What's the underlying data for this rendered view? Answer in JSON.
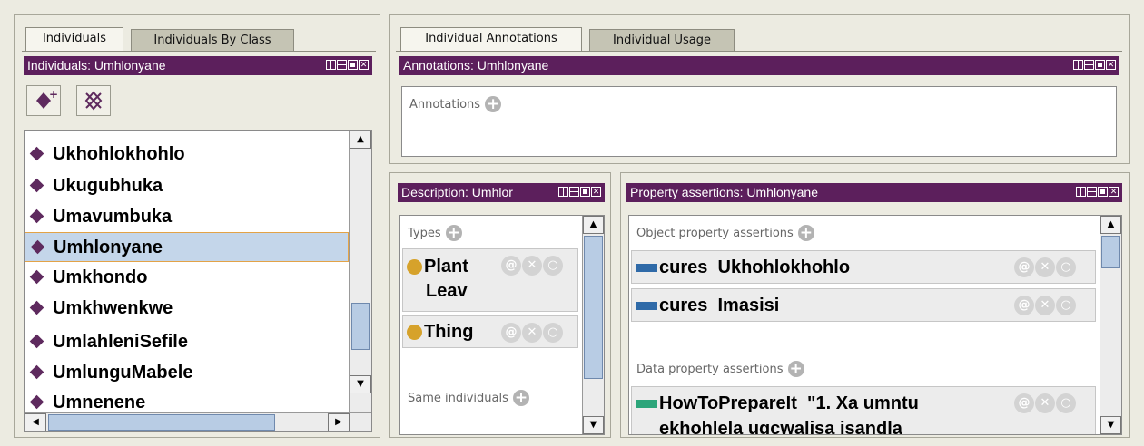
{
  "left_panel": {
    "tabs": [
      "Individuals",
      "Individuals By Class"
    ],
    "title": "Individuals: Umhlonyane",
    "add_individual_icon": "add-individual-icon",
    "delete_individual_icon": "delete-individual-icon",
    "items": [
      {
        "label": "Ukhohlokhohlo"
      },
      {
        "label": "Ukugubhuka"
      },
      {
        "label": "Umavumbuka"
      },
      {
        "label": "Umhlonyane",
        "selected": true
      },
      {
        "label": "Umkhondo"
      },
      {
        "label": "Umkhwenkwe"
      },
      {
        "label": "UmlahleniSefile"
      },
      {
        "label": "UmlunguMabele"
      },
      {
        "label": "Umnenene"
      }
    ]
  },
  "annotations_panel": {
    "tabs": [
      "Individual Annotations",
      "Individual Usage"
    ],
    "title": "Annotations: Umhlonyane",
    "section_label": "Annotations"
  },
  "description_panel": {
    "title": "Description: Umhlor",
    "types_label": "Types",
    "types": [
      {
        "line1": "Plant",
        "line2": "Leav"
      },
      {
        "line1": "Thing",
        "line2": ""
      }
    ],
    "same_individuals_label": "Same individuals"
  },
  "property_panel": {
    "title": "Property assertions: Umhlonyane",
    "object_label": "Object property assertions",
    "object_assertions": [
      {
        "property": "cures",
        "value": "Ukhohlokhohlo"
      },
      {
        "property": "cures",
        "value": "Imasisi"
      }
    ],
    "data_label": "Data property assertions",
    "data_assertions": [
      {
        "property": "HowToPrepareIt",
        "line1": "\"1. Xa umntu",
        "line2": "ekhohlela ugcwalisa isandla"
      }
    ]
  },
  "card_buttons": {
    "annotate": "@",
    "delete": "✕",
    "edit": "○"
  },
  "colors": {
    "title_bar": "#5c1f5c",
    "selection": "#c4d6ea",
    "individual_diamond": "#5e2a5e",
    "class_dot": "#d6a22b",
    "object_property": "#2f6aa8",
    "data_property": "#2ca57a"
  }
}
